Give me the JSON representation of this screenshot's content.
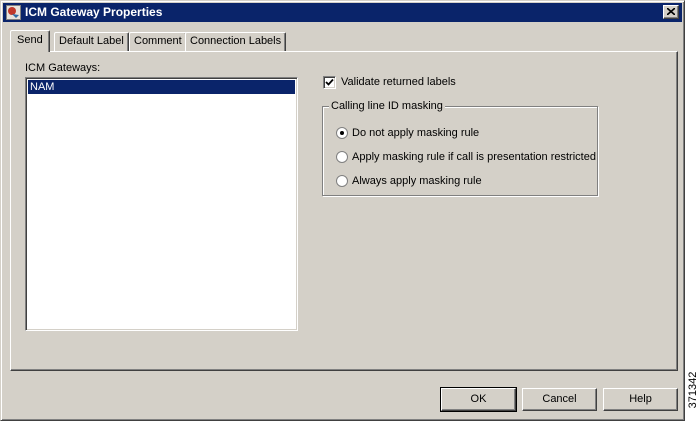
{
  "window": {
    "title": "ICM Gateway Properties",
    "icon": "app-icon",
    "close_icon": "close-icon"
  },
  "tabs": [
    {
      "label": "Send",
      "active": true
    },
    {
      "label": "Default Label",
      "active": false
    },
    {
      "label": "Comment",
      "active": false
    },
    {
      "label": "Connection Labels",
      "active": false
    }
  ],
  "send": {
    "gateways_label": "ICM Gateways:",
    "gateways": [
      {
        "name": "NAM",
        "selected": true
      }
    ],
    "validate": {
      "label": "Validate returned labels",
      "checked": true
    },
    "masking": {
      "title": "Calling line ID masking",
      "options": [
        {
          "label": "Do not apply masking rule",
          "selected": true
        },
        {
          "label": "Apply masking rule if call is presentation restricted",
          "selected": false
        },
        {
          "label": "Always apply masking rule",
          "selected": false
        }
      ]
    }
  },
  "buttons": {
    "ok": "OK",
    "cancel": "Cancel",
    "help": "Help"
  },
  "figure_number": "371342",
  "colors": {
    "face": "#d4d0c8",
    "titlebar": "#0a246a",
    "selection": "#0a246a"
  }
}
